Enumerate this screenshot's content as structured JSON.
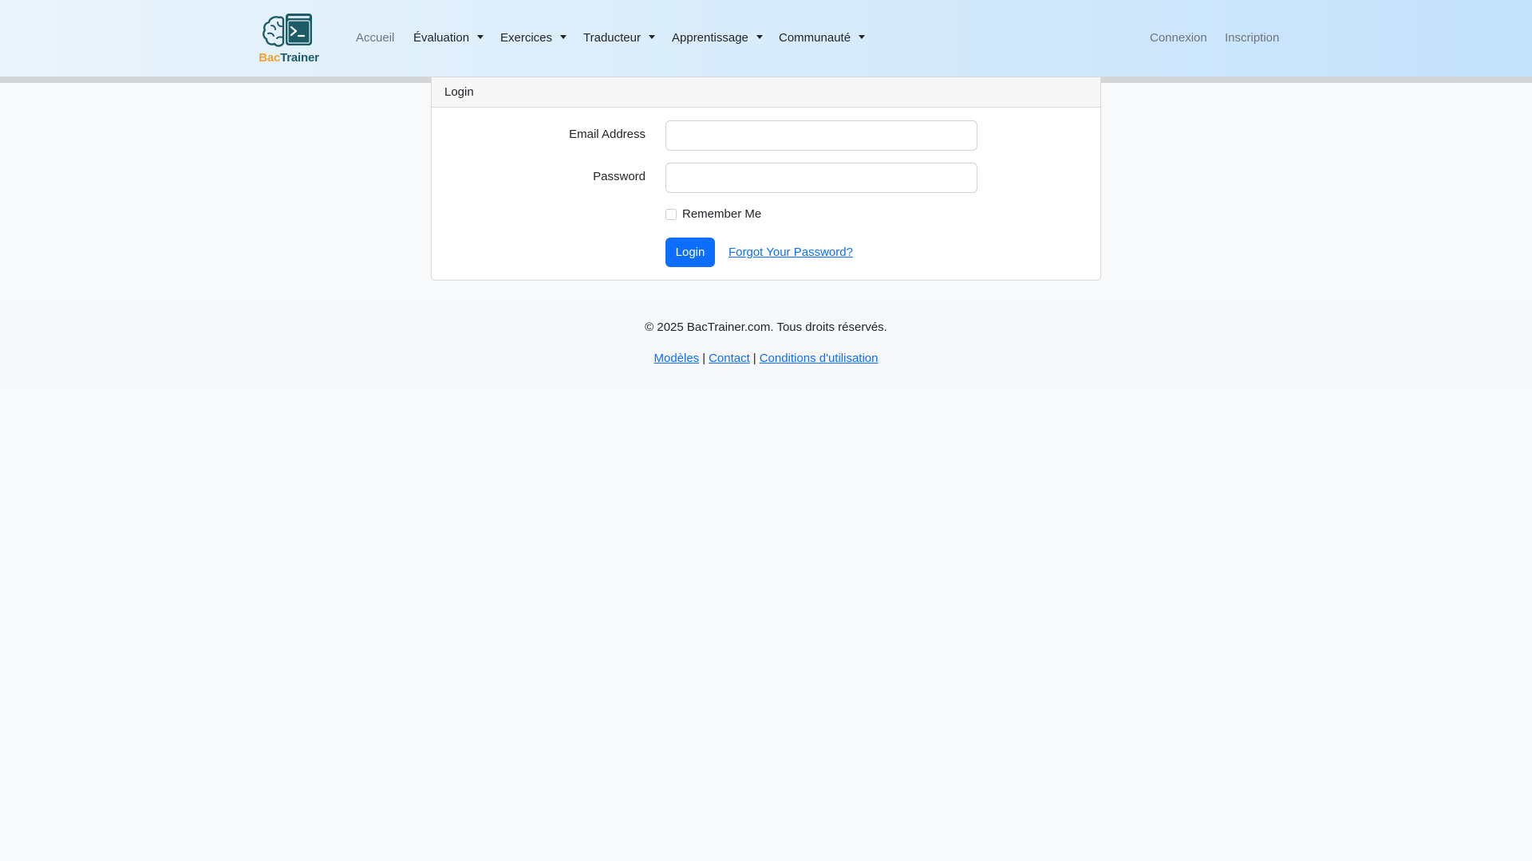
{
  "brand": {
    "part1": "Bac",
    "part2": "Trainer",
    "icon": "brain-terminal-logo"
  },
  "nav": {
    "items": [
      {
        "label": "Accueil",
        "muted": true,
        "dropdown": false
      },
      {
        "label": "Évaluation",
        "dropdown": true
      },
      {
        "label": "Exercices",
        "dropdown": true
      },
      {
        "label": "Traducteur",
        "dropdown": true
      },
      {
        "label": "Apprentissage",
        "dropdown": true
      },
      {
        "label": "Communauté",
        "dropdown": true
      }
    ],
    "right": [
      {
        "label": "Connexion"
      },
      {
        "label": "Inscription"
      }
    ]
  },
  "login": {
    "header": "Login",
    "email_label": "Email Address",
    "email_value": "",
    "password_label": "Password",
    "password_value": "",
    "remember_label": "Remember Me",
    "remember_checked": false,
    "submit_label": "Login",
    "forgot_label": "Forgot Your Password?"
  },
  "footer": {
    "copyright": "© 2025 BacTrainer.com. Tous droits réservés.",
    "links": [
      "Modèles",
      "Contact",
      "Conditions d'utilisation"
    ],
    "separator": "|"
  },
  "colors": {
    "primary": "#0d6efd",
    "brand_orange": "#f0a330",
    "brand_teal": "#1d5b66"
  }
}
